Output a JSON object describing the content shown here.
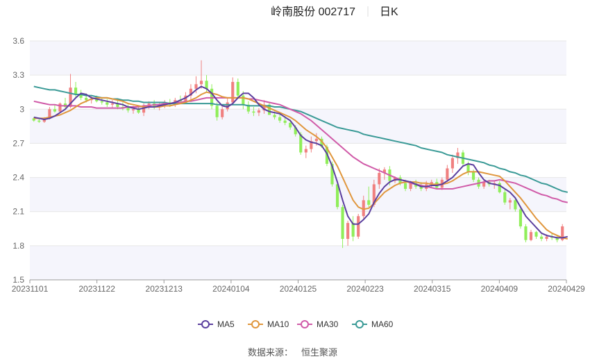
{
  "chart_data": {
    "type": "candlestick",
    "title": "岭南股份 002717",
    "subtitle": "日K",
    "source_label": "数据来源：",
    "source_name": "恒生聚源",
    "y_ticks": [
      "3.6",
      "3.3",
      "3",
      "2.7",
      "2.4",
      "2.1",
      "1.8",
      "1.5"
    ],
    "ylim": [
      1.5,
      3.6
    ],
    "x_tick_labels": [
      "20231101",
      "20231122",
      "20231213",
      "20240104",
      "20240125",
      "20240223",
      "20240315",
      "20240409",
      "20240429"
    ],
    "legend": [
      "MA5",
      "MA10",
      "MA30",
      "MA60"
    ],
    "colors": {
      "up": "#f08080",
      "down": "#90ee5a",
      "MA5": "#5b3f9e",
      "MA10": "#e0963c",
      "MA30": "#d05aa8",
      "MA60": "#3a9a96"
    },
    "ohlc": [
      [
        2.92,
        2.93,
        2.89,
        2.9
      ],
      [
        2.9,
        2.92,
        2.88,
        2.89
      ],
      [
        2.89,
        2.93,
        2.88,
        2.92
      ],
      [
        2.92,
        3.02,
        2.91,
        3.0
      ],
      [
        3.0,
        3.04,
        2.97,
        2.98
      ],
      [
        2.98,
        3.06,
        2.97,
        3.05
      ],
      [
        3.05,
        3.1,
        3.0,
        3.02
      ],
      [
        3.02,
        3.31,
        3.01,
        3.19
      ],
      [
        3.19,
        3.24,
        3.1,
        3.13
      ],
      [
        3.13,
        3.17,
        3.08,
        3.1
      ],
      [
        3.1,
        3.14,
        3.06,
        3.08
      ],
      [
        3.08,
        3.12,
        3.05,
        3.09
      ],
      [
        3.09,
        3.12,
        3.06,
        3.07
      ],
      [
        3.07,
        3.1,
        3.04,
        3.06
      ],
      [
        3.06,
        3.09,
        3.02,
        3.04
      ],
      [
        3.04,
        3.08,
        3.01,
        3.05
      ],
      [
        3.05,
        3.08,
        3.0,
        3.02
      ],
      [
        3.02,
        3.06,
        2.99,
        3.01
      ],
      [
        3.01,
        3.04,
        2.97,
        2.99
      ],
      [
        2.99,
        3.03,
        2.96,
        3.0
      ],
      [
        3.0,
        3.02,
        2.96,
        2.97
      ],
      [
        2.97,
        3.05,
        2.94,
        3.03
      ],
      [
        3.03,
        3.07,
        3.0,
        3.05
      ],
      [
        3.05,
        3.08,
        3.0,
        3.02
      ],
      [
        3.02,
        3.06,
        2.99,
        3.04
      ],
      [
        3.04,
        3.08,
        3.01,
        3.06
      ],
      [
        3.06,
        3.09,
        3.02,
        3.04
      ],
      [
        3.04,
        3.1,
        3.02,
        3.08
      ],
      [
        3.08,
        3.12,
        3.05,
        3.07
      ],
      [
        3.07,
        3.15,
        3.05,
        3.12
      ],
      [
        3.12,
        3.22,
        3.08,
        3.18
      ],
      [
        3.18,
        3.29,
        3.14,
        3.22
      ],
      [
        3.22,
        3.43,
        3.18,
        3.25
      ],
      [
        3.25,
        3.3,
        3.15,
        3.18
      ],
      [
        3.18,
        3.22,
        3.0,
        3.03
      ],
      [
        3.03,
        3.06,
        2.9,
        2.93
      ],
      [
        2.93,
        3.02,
        2.91,
        3.0
      ],
      [
        3.0,
        3.1,
        2.98,
        3.06
      ],
      [
        3.06,
        3.28,
        3.04,
        3.24
      ],
      [
        3.24,
        3.27,
        3.1,
        3.12
      ],
      [
        3.12,
        3.16,
        3.0,
        3.04
      ],
      [
        3.04,
        3.07,
        2.96,
        2.98
      ],
      [
        2.98,
        3.02,
        2.94,
        2.97
      ],
      [
        2.97,
        3.01,
        2.94,
        2.99
      ],
      [
        2.99,
        3.08,
        2.96,
        3.04
      ],
      [
        3.04,
        3.06,
        2.96,
        2.95
      ],
      [
        2.95,
        2.98,
        2.91,
        2.93
      ],
      [
        2.93,
        2.96,
        2.88,
        2.9
      ],
      [
        2.9,
        2.94,
        2.86,
        2.88
      ],
      [
        2.88,
        2.91,
        2.82,
        2.84
      ],
      [
        2.84,
        2.86,
        2.76,
        2.78
      ],
      [
        2.78,
        2.8,
        2.6,
        2.62
      ],
      [
        2.62,
        2.68,
        2.57,
        2.65
      ],
      [
        2.65,
        2.76,
        2.62,
        2.72
      ],
      [
        2.72,
        2.79,
        2.68,
        2.74
      ],
      [
        2.74,
        2.76,
        2.66,
        2.67
      ],
      [
        2.67,
        2.69,
        2.5,
        2.52
      ],
      [
        2.52,
        2.54,
        2.32,
        2.34
      ],
      [
        2.34,
        2.36,
        2.12,
        2.14
      ],
      [
        2.14,
        2.16,
        1.78,
        1.86
      ],
      [
        1.86,
        2.02,
        1.8,
        2.0
      ],
      [
        2.0,
        2.06,
        1.84,
        1.88
      ],
      [
        1.88,
        2.08,
        1.86,
        2.06
      ],
      [
        2.06,
        2.24,
        2.04,
        2.2
      ],
      [
        2.2,
        2.32,
        2.14,
        2.16
      ],
      [
        2.16,
        2.38,
        2.14,
        2.34
      ],
      [
        2.34,
        2.48,
        2.3,
        2.44
      ],
      [
        2.44,
        2.49,
        2.38,
        2.47
      ],
      [
        2.47,
        2.5,
        2.33,
        2.37
      ],
      [
        2.37,
        2.41,
        2.35,
        2.4
      ],
      [
        2.4,
        2.42,
        2.33,
        2.35
      ],
      [
        2.35,
        2.38,
        2.28,
        2.3
      ],
      [
        2.3,
        2.37,
        2.28,
        2.35
      ],
      [
        2.35,
        2.38,
        2.3,
        2.32
      ],
      [
        2.32,
        2.36,
        2.28,
        2.3
      ],
      [
        2.3,
        2.37,
        2.28,
        2.34
      ],
      [
        2.34,
        2.38,
        2.31,
        2.36
      ],
      [
        2.36,
        2.39,
        2.3,
        2.31
      ],
      [
        2.31,
        2.4,
        2.29,
        2.38
      ],
      [
        2.38,
        2.51,
        2.36,
        2.48
      ],
      [
        2.48,
        2.6,
        2.44,
        2.57
      ],
      [
        2.57,
        2.66,
        2.52,
        2.62
      ],
      [
        2.62,
        2.64,
        2.5,
        2.52
      ],
      [
        2.52,
        2.54,
        2.42,
        2.45
      ],
      [
        2.45,
        2.47,
        2.36,
        2.38
      ],
      [
        2.38,
        2.4,
        2.3,
        2.32
      ],
      [
        2.32,
        2.38,
        2.3,
        2.36
      ],
      [
        2.36,
        2.38,
        2.32,
        2.34
      ],
      [
        2.34,
        2.37,
        2.3,
        2.35
      ],
      [
        2.35,
        2.37,
        2.26,
        2.27
      ],
      [
        2.27,
        2.29,
        2.16,
        2.18
      ],
      [
        2.18,
        2.22,
        2.12,
        2.2
      ],
      [
        2.2,
        2.22,
        2.1,
        2.12
      ],
      [
        2.12,
        2.14,
        1.95,
        1.97
      ],
      [
        1.97,
        1.99,
        1.83,
        1.85
      ],
      [
        1.85,
        1.94,
        1.84,
        1.92
      ],
      [
        1.92,
        1.93,
        1.86,
        1.88
      ],
      [
        1.88,
        1.9,
        1.84,
        1.86
      ],
      [
        1.86,
        1.9,
        1.84,
        1.88
      ],
      [
        1.88,
        1.91,
        1.85,
        1.87
      ],
      [
        1.87,
        1.89,
        1.83,
        1.85
      ],
      [
        1.85,
        1.99,
        1.84,
        1.97
      ]
    ],
    "ma5": [
      2.93,
      2.92,
      2.91,
      2.92,
      2.94,
      2.97,
      3.0,
      3.05,
      3.1,
      3.14,
      3.13,
      3.1,
      3.09,
      3.08,
      3.07,
      3.06,
      3.05,
      3.04,
      3.02,
      3.01,
      3.0,
      3.01,
      3.02,
      3.02,
      3.03,
      3.04,
      3.05,
      3.06,
      3.08,
      3.1,
      3.13,
      3.17,
      3.2,
      3.18,
      3.14,
      3.08,
      3.03,
      3.02,
      3.05,
      3.1,
      3.14,
      3.14,
      3.1,
      3.04,
      3.0,
      2.98,
      2.97,
      2.96,
      2.93,
      2.9,
      2.84,
      2.77,
      2.73,
      2.71,
      2.7,
      2.68,
      2.61,
      2.5,
      2.36,
      2.2,
      2.06,
      1.99,
      1.99,
      2.03,
      2.08,
      2.18,
      2.26,
      2.32,
      2.36,
      2.38,
      2.38,
      2.37,
      2.36,
      2.34,
      2.32,
      2.32,
      2.33,
      2.33,
      2.34,
      2.37,
      2.4,
      2.45,
      2.5,
      2.52,
      2.51,
      2.44,
      2.38,
      2.35,
      2.34,
      2.33,
      2.3,
      2.27,
      2.22,
      2.14,
      2.06,
      2.01,
      1.96,
      1.91,
      1.89,
      1.88,
      1.87,
      1.87,
      1.88
    ],
    "ma10": [
      2.92,
      2.92,
      2.92,
      2.93,
      2.94,
      2.95,
      2.97,
      2.99,
      3.02,
      3.05,
      3.07,
      3.09,
      3.1,
      3.1,
      3.1,
      3.09,
      3.08,
      3.07,
      3.05,
      3.04,
      3.03,
      3.02,
      3.02,
      3.02,
      3.02,
      3.03,
      3.03,
      3.04,
      3.05,
      3.06,
      3.08,
      3.1,
      3.13,
      3.15,
      3.14,
      3.13,
      3.11,
      3.1,
      3.1,
      3.1,
      3.1,
      3.09,
      3.07,
      3.05,
      3.03,
      3.01,
      2.99,
      2.97,
      2.95,
      2.93,
      2.9,
      2.86,
      2.82,
      2.79,
      2.76,
      2.72,
      2.66,
      2.58,
      2.5,
      2.4,
      2.3,
      2.2,
      2.14,
      2.12,
      2.13,
      2.17,
      2.22,
      2.27,
      2.3,
      2.33,
      2.35,
      2.36,
      2.36,
      2.36,
      2.35,
      2.35,
      2.34,
      2.34,
      2.34,
      2.35,
      2.37,
      2.4,
      2.43,
      2.45,
      2.45,
      2.45,
      2.44,
      2.43,
      2.42,
      2.41,
      2.37,
      2.32,
      2.27,
      2.22,
      2.16,
      2.1,
      2.04,
      1.99,
      1.94,
      1.91,
      1.89,
      1.87,
      1.86
    ],
    "ma30": [
      3.07,
      3.06,
      3.05,
      3.04,
      3.04,
      3.03,
      3.03,
      3.03,
      3.03,
      3.02,
      3.02,
      3.02,
      3.01,
      3.01,
      3.01,
      3.01,
      3.01,
      3.01,
      3.02,
      3.02,
      3.02,
      3.03,
      3.03,
      3.04,
      3.04,
      3.05,
      3.05,
      3.06,
      3.06,
      3.07,
      3.07,
      3.08,
      3.09,
      3.1,
      3.1,
      3.1,
      3.1,
      3.1,
      3.1,
      3.1,
      3.1,
      3.09,
      3.09,
      3.08,
      3.07,
      3.06,
      3.05,
      3.04,
      3.02,
      3.0,
      2.98,
      2.96,
      2.93,
      2.9,
      2.86,
      2.82,
      2.78,
      2.74,
      2.7,
      2.66,
      2.62,
      2.58,
      2.55,
      2.52,
      2.5,
      2.48,
      2.46,
      2.44,
      2.42,
      2.4,
      2.38,
      2.37,
      2.35,
      2.34,
      2.33,
      2.32,
      2.31,
      2.3,
      2.3,
      2.3,
      2.3,
      2.31,
      2.32,
      2.33,
      2.34,
      2.35,
      2.36,
      2.37,
      2.37,
      2.38,
      2.37,
      2.36,
      2.35,
      2.33,
      2.31,
      2.29,
      2.27,
      2.25,
      2.24,
      2.22,
      2.21,
      2.19,
      2.18
    ],
    "ma60": [
      3.2,
      3.19,
      3.18,
      3.17,
      3.17,
      3.16,
      3.15,
      3.14,
      3.13,
      3.13,
      3.12,
      3.12,
      3.11,
      3.1,
      3.1,
      3.09,
      3.09,
      3.08,
      3.08,
      3.07,
      3.07,
      3.06,
      3.06,
      3.06,
      3.06,
      3.06,
      3.05,
      3.05,
      3.05,
      3.05,
      3.05,
      3.05,
      3.05,
      3.05,
      3.05,
      3.04,
      3.04,
      3.04,
      3.04,
      3.04,
      3.04,
      3.03,
      3.03,
      3.03,
      3.03,
      3.03,
      3.02,
      3.02,
      3.01,
      3.0,
      2.99,
      2.98,
      2.96,
      2.94,
      2.92,
      2.9,
      2.88,
      2.86,
      2.84,
      2.83,
      2.82,
      2.81,
      2.8,
      2.78,
      2.77,
      2.76,
      2.75,
      2.74,
      2.73,
      2.72,
      2.71,
      2.7,
      2.69,
      2.68,
      2.66,
      2.65,
      2.64,
      2.63,
      2.62,
      2.6,
      2.59,
      2.58,
      2.57,
      2.56,
      2.55,
      2.54,
      2.53,
      2.51,
      2.5,
      2.48,
      2.47,
      2.45,
      2.44,
      2.42,
      2.41,
      2.39,
      2.37,
      2.35,
      2.34,
      2.32,
      2.3,
      2.28,
      2.27
    ]
  }
}
